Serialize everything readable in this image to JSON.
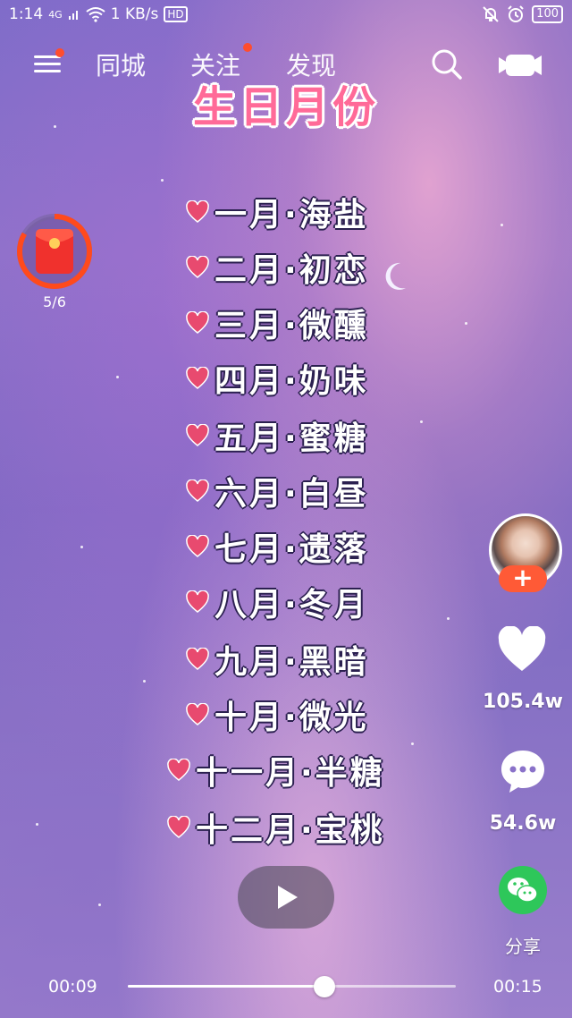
{
  "status_bar": {
    "time": "1:14",
    "network": "4G",
    "speed": "1 KB/s",
    "hd": "HD",
    "battery": "100"
  },
  "top_nav": {
    "tabs": [
      {
        "label": "同城",
        "has_dot": false
      },
      {
        "label": "关注",
        "has_dot": true
      },
      {
        "label": "发现",
        "has_dot": false
      }
    ],
    "menu_has_dot": true
  },
  "video": {
    "title": "生日月份",
    "months": [
      "一月·海盐",
      "二月·初恋",
      "三月·微醺",
      "四月·奶味",
      "五月·蜜糖",
      "六月·白昼",
      "七月·遗落",
      "八月·冬月",
      "九月·黑暗",
      "十月·微光",
      "十一月·半糖",
      "十二月·宝桃"
    ]
  },
  "red_packet": {
    "progress": "5/6",
    "progress_value": 0.8333
  },
  "right_rail": {
    "follow_label": "+",
    "likes": "105.4w",
    "comments": "54.6w",
    "share": "分享"
  },
  "player": {
    "current_time": "00:09",
    "total_time": "00:15",
    "progress_fraction": 0.6
  },
  "colors": {
    "accent": "#ff5a36",
    "heart": "#e84a6f",
    "wechat": "#2ec75a",
    "title": "#ff6a98"
  }
}
